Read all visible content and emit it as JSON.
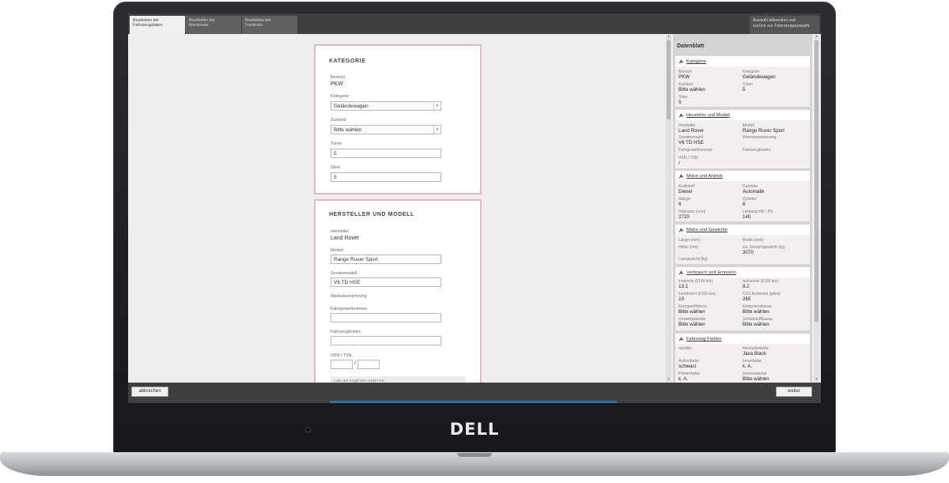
{
  "tabs": [
    {
      "line1": "Bearbeiten der",
      "line2": "Fahrzeugdaten"
    },
    {
      "line1": "Bearbeiten der",
      "line2": "Merkmale"
    },
    {
      "line1": "Bearbeiten der",
      "line2": "Freitexte"
    }
  ],
  "tab_right": {
    "line1": "Auswahl abbrechen und",
    "line2": "zurück zur Fahrzeugauswahl"
  },
  "kategorie_card": {
    "heading": "KATEGORIE",
    "bereich_label": "Bereich",
    "bereich_value": "PKW",
    "kategorie_label": "Kategorie",
    "kategorie_value": "Geländewagen",
    "zustand_label": "Zustand",
    "zustand_value": "Bitte wählen",
    "tueren_label": "Türen",
    "tueren_value": "5",
    "sitze_label": "Sitze",
    "sitze_value": "5"
  },
  "hersteller_card": {
    "heading": "HERSTELLER UND MODELL",
    "hersteller_label": "Hersteller",
    "hersteller_value": "Land Rover",
    "modell_label": "Modell",
    "modell_value": "Range Rover Sport",
    "sondermodell_label": "Sondermodell",
    "sondermodell_value": "V6 TD HSE",
    "werksbezeichnung_label": "Werksbezeichnung",
    "fahrgestellnummer_label": "Fahrgestellnummer",
    "fahrzeugbrief_label": "Fahrzeugbriefnr.",
    "hsn_tsn_label": "HSN / TSN",
    "hsn_slash": "/",
    "hint": "Liste der möglichen HSN/TSN"
  },
  "panel": {
    "title": "Datenblatt",
    "sections": {
      "kategorie": {
        "title": "Kategorie",
        "cells": [
          {
            "label": "Bereich",
            "value": "PKW"
          },
          {
            "label": "Kategorie",
            "value": "Geländewagen"
          },
          {
            "label": "Zustand",
            "value": "Bitte wählen"
          },
          {
            "label": "Türen",
            "value": "5"
          },
          {
            "label": "Sitze",
            "value": "5"
          }
        ]
      },
      "hersteller": {
        "title": "Hersteller und Modell",
        "cells": [
          {
            "label": "Hersteller",
            "value": "Land Rover"
          },
          {
            "label": "Modell",
            "value": "Range Rover Sport"
          },
          {
            "label": "Sondermodell",
            "value": "V6 TD HSE"
          },
          {
            "label": "Werksbezeichnung",
            "value": ""
          },
          {
            "label": "Fahrgestellnummer",
            "value": ""
          },
          {
            "label": "Fahrzeugbriefnr.",
            "value": ""
          },
          {
            "label": "HSN / TSN",
            "value": "/"
          }
        ]
      },
      "motor": {
        "title": "Motor und Antrieb",
        "cells": [
          {
            "label": "Kraftstoff",
            "value": "Diesel"
          },
          {
            "label": "Getriebe",
            "value": "Automatik"
          },
          {
            "label": "Gänge",
            "value": "6"
          },
          {
            "label": "Zylinder",
            "value": "6"
          },
          {
            "label": "Hubraum (ccm)",
            "value": "2720"
          },
          {
            "label": "Leistung kW / PS",
            "value": "140"
          }
        ]
      },
      "masse": {
        "title": "Maße und Gewichte",
        "cells": [
          {
            "label": "Länge (mm)",
            "value": ""
          },
          {
            "label": "Breite (mm)",
            "value": ""
          },
          {
            "label": "Höhe (mm)",
            "value": ""
          },
          {
            "label": "zul. Gesamtgewicht (kg)",
            "value": "3070"
          },
          {
            "label": "Leergewicht (kg)",
            "value": ""
          }
        ]
      },
      "verbrauch": {
        "title": "Verbrauch und Emission",
        "cells": [
          {
            "label": "innerorts (l/100 km)",
            "value": "13.1"
          },
          {
            "label": "außerorts (l/100 km)",
            "value": "8.2"
          },
          {
            "label": "kombiniert (l/100 km)",
            "value": "10"
          },
          {
            "label": "CO2-Emission (g/km)",
            "value": "265"
          },
          {
            "label": "Energieeffizienz",
            "value": "Bitte wählen"
          },
          {
            "label": "Emissionsklasse",
            "value": "Bitte wählen"
          },
          {
            "label": "Umweltplakette",
            "value": "Bitte wählen"
          },
          {
            "label": "Schadstoffklasse",
            "value": "Bitte wählen"
          }
        ]
      },
      "farben": {
        "title": "Fahrzeug Farben",
        "cells": [
          {
            "label": "metallic",
            "value": ""
          },
          {
            "label": "Herstellerfarbe",
            "value": "Java Black"
          },
          {
            "label": "Außenfarbe",
            "value": "schwarz"
          },
          {
            "label": "Innenfarbe",
            "value": "k. A."
          },
          {
            "label": "Polsterfarbe",
            "value": "k. A."
          },
          {
            "label": "Innenmaterial",
            "value": "Bitte wählen"
          }
        ]
      }
    }
  },
  "buttons": {
    "cancel": "abbrechen",
    "next": "weiter"
  },
  "brand": {
    "logo": "DELL"
  }
}
